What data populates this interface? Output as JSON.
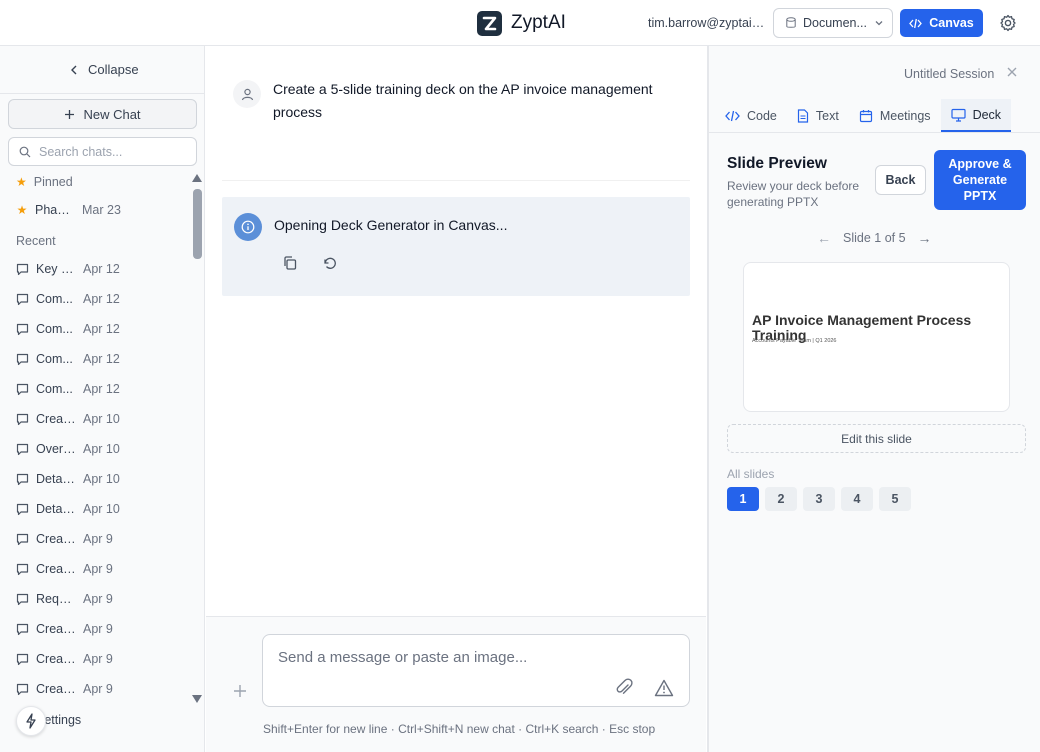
{
  "header": {
    "app_title": "ZyptAI",
    "user_email": "tim.barrow@zyptai.c...",
    "document_select": "Documen...",
    "canvas_button": "Canvas"
  },
  "sidebar": {
    "collapse_label": "Collapse",
    "new_chat_label": "New Chat",
    "search_placeholder": "Search chats...",
    "pinned_label": "Pinned",
    "pinned_items": [
      {
        "name": "Phase...",
        "date": "Mar 23"
      }
    ],
    "recent_label": "Recent",
    "recent_items": [
      {
        "name": "Key S...",
        "date": "Apr 12"
      },
      {
        "name": "Com...",
        "date": "Apr 12"
      },
      {
        "name": "Com...",
        "date": "Apr 12"
      },
      {
        "name": "Com...",
        "date": "Apr 12"
      },
      {
        "name": "Com...",
        "date": "Apr 12"
      },
      {
        "name": "Creati...",
        "date": "Apr 10"
      },
      {
        "name": "Overv...",
        "date": "Apr 10"
      },
      {
        "name": "Detail...",
        "date": "Apr 10"
      },
      {
        "name": "Detail...",
        "date": "Apr 10"
      },
      {
        "name": "Creatin...",
        "date": "Apr 9"
      },
      {
        "name": "Creatin...",
        "date": "Apr 9"
      },
      {
        "name": "Reque...",
        "date": "Apr 9"
      },
      {
        "name": "Creatin...",
        "date": "Apr 9"
      },
      {
        "name": "Creatin...",
        "date": "Apr 9"
      },
      {
        "name": "Creatin...",
        "date": "Apr 9"
      }
    ],
    "settings_label": "Settings"
  },
  "chat": {
    "user_message": "Create a 5-slide training deck on the AP invoice management process",
    "ai_message": "Opening Deck Generator in Canvas...",
    "composer_placeholder": "Send a message or paste an image...",
    "hint": "Shift+Enter for new line · Ctrl+Shift+N new chat · Ctrl+K search · Esc stop"
  },
  "panel": {
    "session_title": "Untitled Session",
    "tabs": [
      {
        "label": "Code",
        "icon": "code-icon"
      },
      {
        "label": "Text",
        "icon": "document-icon"
      },
      {
        "label": "Meetings",
        "icon": "calendar-icon"
      },
      {
        "label": "Deck",
        "icon": "monitor-icon"
      }
    ],
    "active_tab": "Deck",
    "preview_title": "Slide Preview",
    "preview_subtitle": "Review your deck before generating PPTX",
    "back_button": "Back",
    "approve_button": "Approve & Generate PPTX",
    "slide_counter": "Slide 1 of 5",
    "slide": {
      "title": "AP Invoice Management Process Training",
      "subtitle": "Accounts Payable Team | Q1 2026"
    },
    "edit_slide": "Edit this slide",
    "all_slides_label": "All slides",
    "slide_numbers": [
      "1",
      "2",
      "3",
      "4",
      "5"
    ],
    "active_slide": "1"
  },
  "colors": {
    "accent": "#2563eb",
    "star": "#f59e0b",
    "info_icon": "#5b8fd8"
  }
}
